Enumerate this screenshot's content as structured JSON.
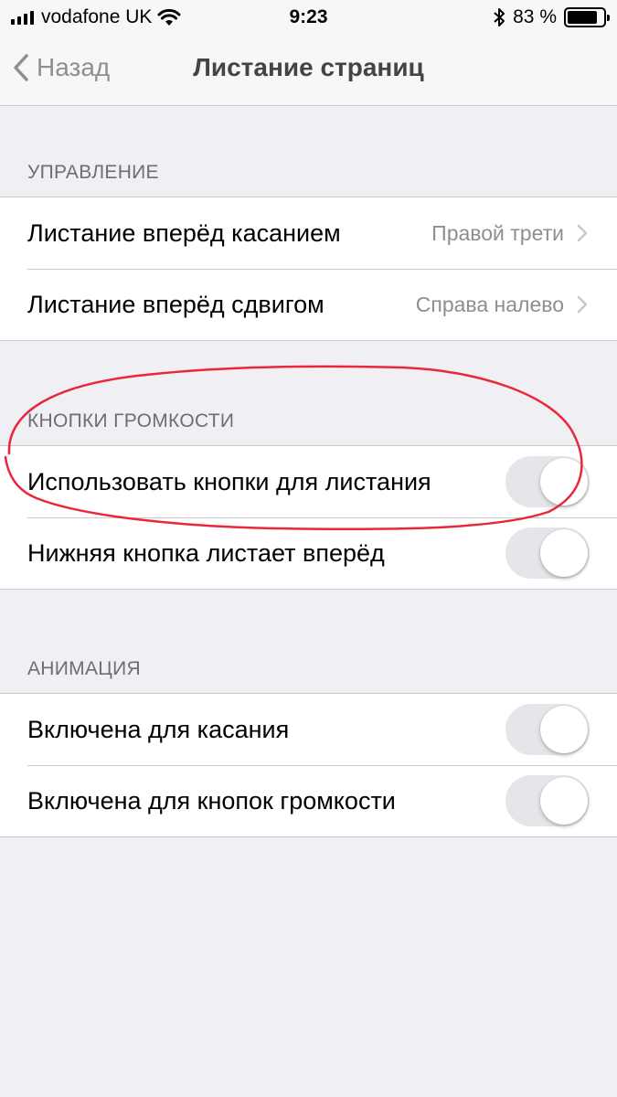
{
  "status_bar": {
    "carrier": "vodafone UK",
    "time": "9:23",
    "battery_percent": "83 %",
    "battery_level": 0.83
  },
  "nav": {
    "back_label": "Назад",
    "title": "Листание страниц"
  },
  "sections": {
    "control": {
      "header": "УПРАВЛЕНИЕ",
      "rows": [
        {
          "label": "Листание вперёд касанием",
          "value": "Правой трети"
        },
        {
          "label": "Листание вперёд сдвигом",
          "value": "Справа налево"
        }
      ]
    },
    "volume": {
      "header": "КНОПКИ ГРОМКОСТИ",
      "rows": [
        {
          "label": "Использовать кнопки для листания",
          "toggle": false
        },
        {
          "label": "Нижняя кнопка листает вперёд",
          "toggle": false
        }
      ]
    },
    "animation": {
      "header": "АНИМАЦИЯ",
      "rows": [
        {
          "label": "Включена для касания",
          "toggle": false
        },
        {
          "label": "Включена для кнопок громкости",
          "toggle": false
        }
      ]
    }
  },
  "colors": {
    "background": "#efeff4",
    "annotation": "#e8283a",
    "secondary_text": "#8e8e93",
    "toggle_off": "#e5e5ea"
  },
  "icons": [
    "signal-icon",
    "wifi-icon",
    "bluetooth-icon",
    "battery-icon",
    "back-chevron-icon",
    "chevron-right-icon"
  ]
}
